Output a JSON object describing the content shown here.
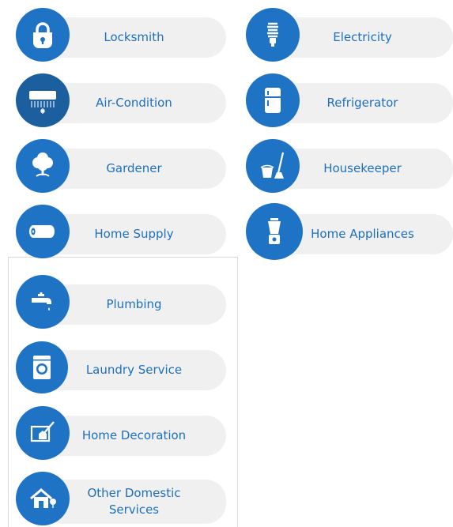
{
  "colors": {
    "accent": "#1f73c4",
    "label": "#1e6fbf",
    "pill": "#f0f0f0"
  },
  "services": [
    {
      "label": "Locksmith",
      "icon": "lock-icon"
    },
    {
      "label": "Electricity",
      "icon": "lightbulb-icon"
    },
    {
      "label": "Air-Condition",
      "icon": "air-conditioner-icon"
    },
    {
      "label": "Refrigerator",
      "icon": "refrigerator-icon"
    },
    {
      "label": "Gardener",
      "icon": "tree-icon"
    },
    {
      "label": "Housekeeper",
      "icon": "mop-bucket-icon"
    },
    {
      "label": "Home Supply",
      "icon": "toilet-paper-icon"
    },
    {
      "label": "Home Appliances",
      "icon": "blender-icon"
    },
    {
      "label": "Plumbing",
      "icon": "faucet-icon"
    },
    {
      "label": "Laundry Service",
      "icon": "washing-machine-icon"
    },
    {
      "label": "Home Decoration",
      "icon": "paint-brush-icon"
    },
    {
      "label": "Other Domestic Services",
      "icon": "house-icon"
    }
  ]
}
